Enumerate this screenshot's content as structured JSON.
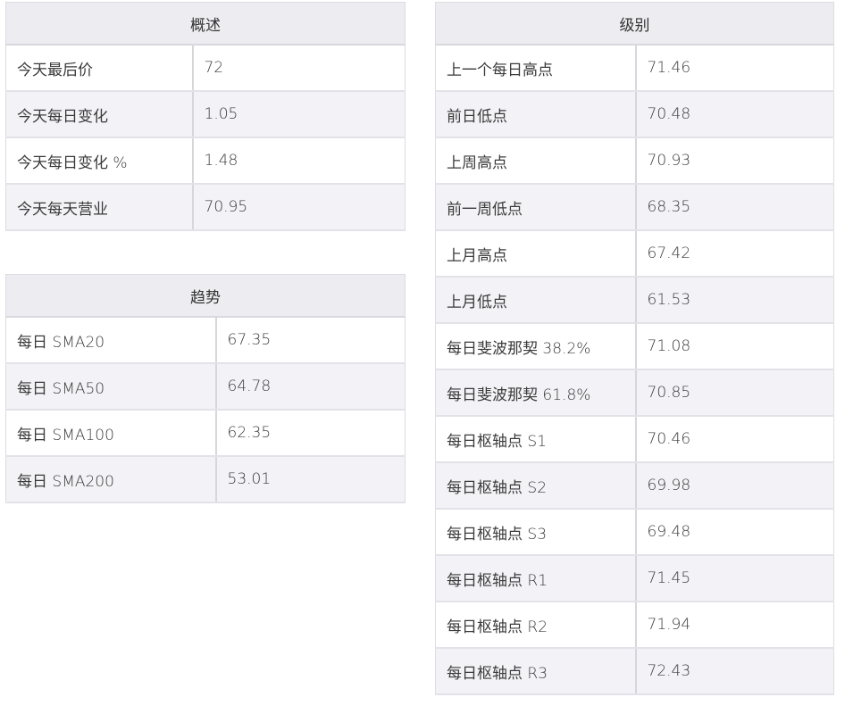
{
  "overview": {
    "title": "概述",
    "rows": [
      {
        "label": "今天最后价",
        "value": "72"
      },
      {
        "label": "今天每日变化",
        "value": "1.05"
      },
      {
        "label": "今天每日变化 %",
        "value": "1.48"
      },
      {
        "label": "今天每天营业",
        "value": "70.95"
      }
    ]
  },
  "trend": {
    "title": "趋势",
    "rows": [
      {
        "label": "每日 SMA20",
        "value": "67.35"
      },
      {
        "label": "每日 SMA50",
        "value": "64.78"
      },
      {
        "label": "每日 SMA100",
        "value": "62.35"
      },
      {
        "label": "每日 SMA200",
        "value": "53.01"
      }
    ]
  },
  "levels": {
    "title": "级别",
    "rows": [
      {
        "label": "上一个每日高点",
        "value": "71.46"
      },
      {
        "label": "前日低点",
        "value": "70.48"
      },
      {
        "label": "上周高点",
        "value": "70.93"
      },
      {
        "label": "前一周低点",
        "value": "68.35"
      },
      {
        "label": "上月高点",
        "value": "67.42"
      },
      {
        "label": "上月低点",
        "value": "61.53"
      },
      {
        "label": "每日斐波那契 38.2%",
        "value": "71.08"
      },
      {
        "label": "每日斐波那契 61.8%",
        "value": "70.85"
      },
      {
        "label": "每日枢轴点 S1",
        "value": "70.46"
      },
      {
        "label": "每日枢轴点 S2",
        "value": "69.98"
      },
      {
        "label": "每日枢轴点 S3",
        "value": "69.48"
      },
      {
        "label": "每日枢轴点 R1",
        "value": "71.45"
      },
      {
        "label": "每日枢轴点 R2",
        "value": "71.94"
      },
      {
        "label": "每日枢轴点 R3",
        "value": "72.43"
      }
    ]
  },
  "colors": {
    "header_bg": "#ececf1",
    "row_alt_bg": "#f3f3f7",
    "border": "#dcdce2",
    "text": "#3a3a3a"
  }
}
